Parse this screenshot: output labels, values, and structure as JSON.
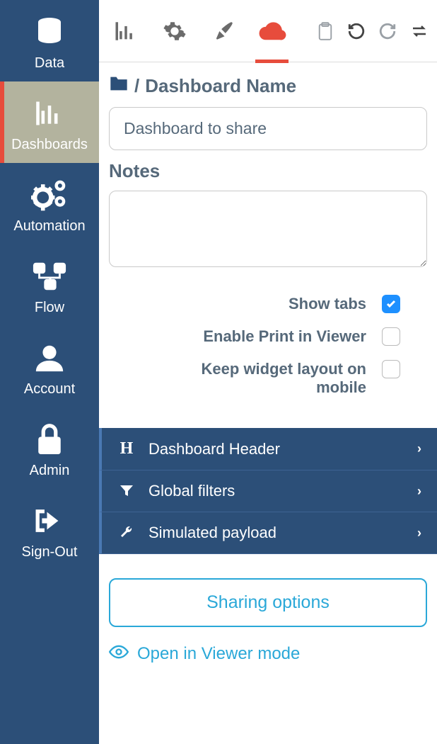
{
  "sidebar": {
    "items": [
      {
        "label": "Data"
      },
      {
        "label": "Dashboards"
      },
      {
        "label": "Automation"
      },
      {
        "label": "Flow"
      },
      {
        "label": "Account"
      },
      {
        "label": "Admin"
      },
      {
        "label": "Sign-Out"
      }
    ],
    "active_index": 1
  },
  "toolbar": {
    "tabs": [
      "chart",
      "settings",
      "style",
      "cloud"
    ],
    "active_tab": "cloud"
  },
  "panel": {
    "breadcrumb_title": "Dashboard Name",
    "breadcrumb_sep": "/",
    "name_value": "Dashboard to share",
    "notes_label": "Notes",
    "notes_value": "",
    "options": [
      {
        "label": "Show tabs",
        "checked": true
      },
      {
        "label": "Enable Print in Viewer",
        "checked": false
      },
      {
        "label": "Keep widget layout on mobile",
        "checked": false
      }
    ],
    "accordion": [
      {
        "label": "Dashboard Header"
      },
      {
        "label": "Global filters"
      },
      {
        "label": "Simulated payload"
      }
    ],
    "share_button": "Sharing options",
    "viewer_link": "Open in Viewer mode"
  }
}
